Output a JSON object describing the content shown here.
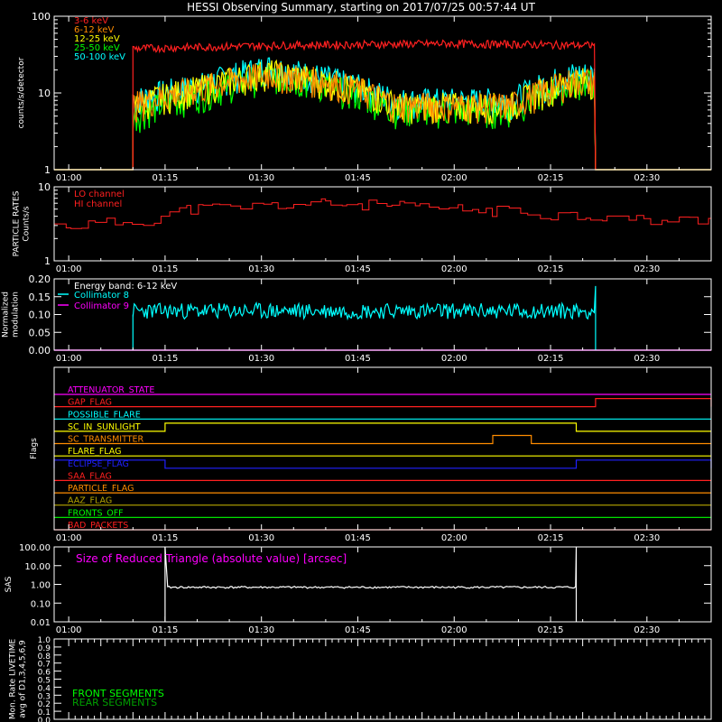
{
  "title": "HESSI Observing Summary, starting on 2017/07/25 00:57:44 UT",
  "time_ticks": [
    "01:00",
    "01:15",
    "01:30",
    "01:45",
    "02:00",
    "02:15",
    "02:30"
  ],
  "chart_data": [
    {
      "type": "line",
      "panel": "count_rates",
      "ylabel": "counts/s/detector",
      "yscale": "log",
      "ylim": [
        1,
        100
      ],
      "y_ticks": [
        "1",
        "10",
        "100"
      ],
      "coverage": {
        "start": "01:10",
        "end": "02:22"
      },
      "series": [
        {
          "name": "3-6 keV",
          "color": "#ff2020",
          "profile": [
            [
              1.0,
              38
            ],
            [
              25.0,
              42
            ],
            [
              50.0,
              44
            ],
            [
              82.0,
              41
            ]
          ]
        },
        {
          "name": "6-12 keV",
          "color": "#ff8c00",
          "profile": [
            [
              1.0,
              7
            ],
            [
              12.0,
              12
            ],
            [
              22.0,
              18
            ],
            [
              32.0,
              14
            ],
            [
              42.0,
              7
            ],
            [
              60.0,
              7
            ],
            [
              70.0,
              15
            ],
            [
              82.0,
              13
            ]
          ]
        },
        {
          "name": "12-25 keV",
          "color": "#ffff00",
          "profile": [
            [
              1.0,
              7
            ],
            [
              12.0,
              12
            ],
            [
              22.0,
              19
            ],
            [
              32.0,
              14
            ],
            [
              42.0,
              7
            ],
            [
              60.0,
              7
            ],
            [
              70.0,
              15
            ],
            [
              82.0,
              14
            ]
          ]
        },
        {
          "name": "25-50 keV",
          "color": "#00ff00",
          "profile": [
            [
              1.0,
              5
            ],
            [
              12.0,
              10
            ],
            [
              22.0,
              17
            ],
            [
              32.0,
              12
            ],
            [
              42.0,
              6
            ],
            [
              60.0,
              6
            ],
            [
              70.0,
              14
            ],
            [
              82.0,
              13
            ]
          ]
        },
        {
          "name": "50-100 keV",
          "color": "#00ffff",
          "profile": [
            [
              1.0,
              8
            ],
            [
              12.0,
              13
            ],
            [
              22.0,
              22
            ],
            [
              32.0,
              15
            ],
            [
              42.0,
              8
            ],
            [
              60.0,
              8
            ],
            [
              70.0,
              18
            ],
            [
              82.0,
              15
            ]
          ]
        }
      ]
    },
    {
      "type": "line",
      "panel": "particle_rates",
      "ylabel": "PARTICLE RATES\nCounts/s",
      "yscale": "log",
      "ylim": [
        1,
        10
      ],
      "y_ticks": [
        "1",
        "10"
      ],
      "series": [
        {
          "name": "LO channel",
          "color": "#ff2020",
          "levels": [
            [
              0,
              3
            ],
            [
              12,
              3.5
            ],
            [
              18,
              5
            ],
            [
              40,
              6
            ],
            [
              60,
              5
            ],
            [
              82,
              4
            ],
            [
              90,
              3.5
            ]
          ]
        },
        {
          "name": "HI channel",
          "color": "#ff2020",
          "levels": []
        }
      ]
    },
    {
      "type": "line",
      "panel": "modulation",
      "ylabel": "Normalized\nmodulation",
      "ylim": [
        0.0,
        0.2
      ],
      "y_ticks": [
        "0.00",
        "0.05",
        "0.10",
        "0.15",
        "0.20"
      ],
      "annotation": "Energy band: 6-12 keV",
      "coverage": {
        "start": "01:10",
        "end": "02:22"
      },
      "series": [
        {
          "name": "Collimator 8",
          "color": "#00ffff",
          "mean": 0.11
        },
        {
          "name": "Collimator 9",
          "color": "#ff00ff",
          "mean": 0.0
        }
      ]
    },
    {
      "type": "line",
      "panel": "flags",
      "ylabel": "Flags",
      "flags": [
        {
          "name": "ATTENUATOR_STATE",
          "color": "#ff00ff",
          "segments": []
        },
        {
          "name": "GAP_FLAG",
          "color": "#ff2020",
          "segments": [
            [
              "02:22",
              "02:40"
            ]
          ]
        },
        {
          "name": "POSSIBLE_FLARE",
          "color": "#00ffff",
          "segments": []
        },
        {
          "name": "SC_IN_SUNLIGHT",
          "color": "#ffff00",
          "segments": [
            [
              "01:15",
              "02:19"
            ]
          ]
        },
        {
          "name": "SC_TRANSMITTER",
          "color": "#ff8c00",
          "segments": [
            [
              "02:06",
              "02:12"
            ]
          ]
        },
        {
          "name": "FLARE_FLAG",
          "color": "#ffff00",
          "segments": []
        },
        {
          "name": "ECLIPSE_FLAG",
          "color": "#2020ff",
          "segments": [
            [
              "00:57",
              "01:15"
            ],
            [
              "02:19",
              "02:40"
            ]
          ]
        },
        {
          "name": "SAA_FLAG",
          "color": "#ff2020",
          "segments": []
        },
        {
          "name": "PARTICLE_FLAG",
          "color": "#ff8c00",
          "segments": []
        },
        {
          "name": "AAZ_FLAG",
          "color": "#b5a400",
          "segments": []
        },
        {
          "name": "FRONTS_OFF",
          "color": "#00ff00",
          "segments": []
        },
        {
          "name": "BAD_PACKETS",
          "color": "#ff2020",
          "segments": []
        }
      ]
    },
    {
      "type": "line",
      "panel": "sas",
      "ylabel": "SAS",
      "yscale": "log",
      "ylim": [
        0.01,
        100
      ],
      "y_ticks": [
        "0.01",
        "0.10",
        "1.00",
        "10.00",
        "100.00"
      ],
      "annotation": "Size of Reduced Triangle (absolute value) [arcsec]",
      "series": [
        {
          "name": "Size of Reduced Triangle",
          "color": "#ffffff",
          "typical": 0.7,
          "span": [
            "01:15",
            "02:19"
          ]
        }
      ]
    },
    {
      "type": "line",
      "panel": "livetime",
      "ylabel": "Mon. Rate LIVETIME\navg of D1,3,4,5,6,9",
      "ylim": [
        0.0,
        1.0
      ],
      "y_ticks": [
        "0.0",
        "0.1",
        "0.2",
        "0.3",
        "0.4",
        "0.5",
        "0.6",
        "0.7",
        "0.8",
        "0.9",
        "1.0"
      ],
      "series": [
        {
          "name": "FRONT SEGMENTS",
          "color": "#00ff00"
        },
        {
          "name": "REAR SEGMENTS",
          "color": "#00a000"
        }
      ]
    }
  ]
}
